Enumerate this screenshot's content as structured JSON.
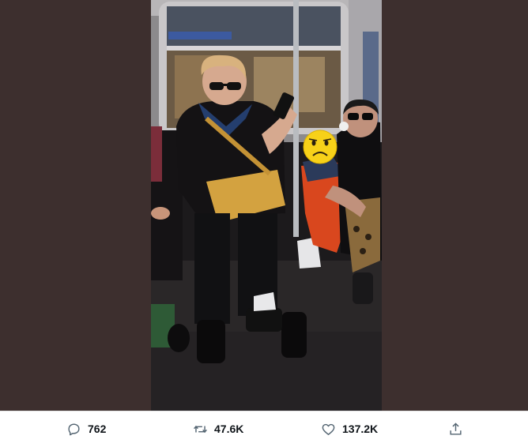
{
  "photo": {
    "alt": "",
    "overlay": "sad-face-emoji"
  },
  "actions": {
    "reply": {
      "icon": "reply-icon",
      "count": "762"
    },
    "retweet": {
      "icon": "retweet-icon",
      "count": "47.6K"
    },
    "like": {
      "icon": "heart-icon",
      "count": "137.2K"
    },
    "share": {
      "icon": "share-icon"
    }
  },
  "colors": {
    "background": "#3d2f2e",
    "action_icon": "#536471",
    "action_text": "#0f1419"
  }
}
